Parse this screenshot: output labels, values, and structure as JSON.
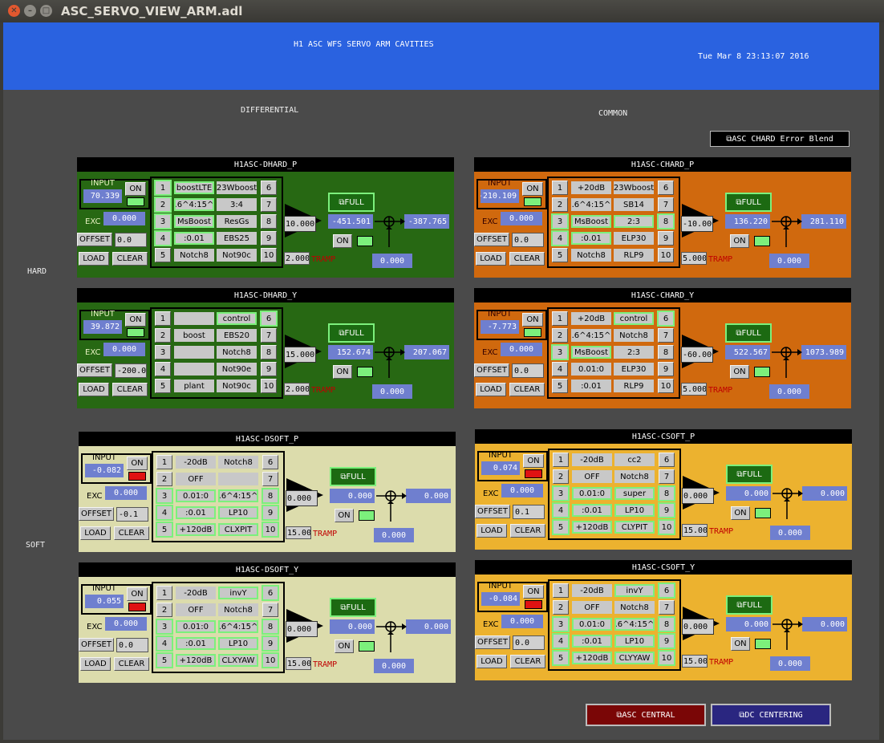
{
  "window": {
    "title": "ASC_SERVO_VIEW_ARM.adl"
  },
  "header": {
    "title": "H1 ASC WFS SERVO ARM CAVITIES",
    "datetime": "Tue Mar  8 23:13:07 2016"
  },
  "labels": {
    "differential": "DIFFERENTIAL",
    "common": "COMMON",
    "hard": "HARD",
    "soft": "SOFT"
  },
  "blend_button": "⧉ASC CHARD Error Blend",
  "common_labels": {
    "input": "INPUT",
    "exc": "EXC",
    "on": "ON",
    "offset": "OFFSET",
    "load": "LOAD",
    "clear": "CLEAR",
    "full": "⧉FULL",
    "tramp": "TRAMP"
  },
  "panels": [
    {
      "title": "H1ASC-DHARD_P",
      "input": "70.339",
      "exc": "0.000",
      "offset": "0.0",
      "gain": "10.000",
      "tramp": "2.000",
      "filters": [
        "boostLTE",
        ".6^4:15^",
        "MsBoost",
        ":0.01",
        "Notch8",
        "23Wboost",
        "3:4",
        "ResGs",
        "EBS25",
        "Not90c"
      ],
      "filter_on": [
        true,
        true,
        true,
        true,
        false,
        false,
        false,
        false,
        false,
        false
      ],
      "inmon": "-451.501",
      "out": "-387.765",
      "bottom": "0.000",
      "input_led": "on",
      "out_led": "on"
    },
    {
      "title": "H1ASC-DHARD_Y",
      "input": "39.872",
      "exc": "0.000",
      "offset": "-200.0",
      "gain": "15.000",
      "tramp": "2.000",
      "filters": [
        "",
        "boost",
        "",
        "",
        "plant",
        "control",
        "EBS20",
        "Notch8",
        "Not90e",
        "Not90c"
      ],
      "filter_on": [
        false,
        false,
        false,
        false,
        false,
        true,
        false,
        false,
        false,
        false
      ],
      "inmon": "152.674",
      "out": "207.067",
      "bottom": "0.000",
      "input_led": "on",
      "out_led": "on"
    },
    {
      "title": "H1ASC-DSOFT_P",
      "input": "-0.082",
      "exc": "0.000",
      "offset": "-0.1",
      "gain": "0.000",
      "tramp": "15.000",
      "filters": [
        "-20dB",
        "OFF",
        "0.01:0",
        ":0.01",
        "+120dB",
        "Notch8",
        "",
        ".6^4:15^",
        "LP10",
        "CLXPIT"
      ],
      "filter_on": [
        false,
        false,
        true,
        true,
        true,
        false,
        false,
        true,
        true,
        true
      ],
      "inmon": "0.000",
      "out": "0.000",
      "bottom": "0.000",
      "input_led": "off",
      "out_led": "on"
    },
    {
      "title": "H1ASC-DSOFT_Y",
      "input": "0.055",
      "exc": "0.000",
      "offset": "0.0",
      "gain": "0.000",
      "tramp": "15.000",
      "filters": [
        "-20dB",
        "OFF",
        "0.01:0",
        ":0.01",
        "+120dB",
        "invY",
        "Notch8",
        ".6^4:15^",
        "LP10",
        "CLXYAW"
      ],
      "filter_on": [
        false,
        false,
        true,
        true,
        true,
        true,
        false,
        true,
        true,
        true
      ],
      "inmon": "0.000",
      "out": "0.000",
      "bottom": "0.000",
      "input_led": "off",
      "out_led": "on"
    },
    {
      "title": "H1ASC-CHARD_P",
      "input": "-210.109",
      "exc": "0.000",
      "offset": "0.0",
      "gain": "-10.000",
      "tramp": "5.000",
      "filters": [
        "+20dB",
        ".6^4:15^",
        "MsBoost",
        ":0.01",
        "Notch8",
        "23Wboost",
        "SB14",
        "2:3",
        "ELP30",
        "RLP9"
      ],
      "filter_on": [
        false,
        false,
        true,
        true,
        false,
        false,
        false,
        true,
        false,
        false
      ],
      "inmon": "136.220",
      "out": "281.110",
      "bottom": "0.000",
      "input_led": "on",
      "out_led": "on"
    },
    {
      "title": "H1ASC-CHARD_Y",
      "input": "-7.773",
      "exc": "0.000",
      "offset": "0.0",
      "gain": "-60.000",
      "tramp": "5.000",
      "filters": [
        "+20dB",
        ".6^4:15^",
        "MsBoost",
        "0.01:0",
        ":0.01",
        "control",
        "Notch8",
        "2:3",
        "ELP30",
        "RLP9"
      ],
      "filter_on": [
        false,
        false,
        true,
        false,
        false,
        true,
        false,
        false,
        false,
        false
      ],
      "inmon": "522.567",
      "out": "1073.989",
      "bottom": "0.000",
      "input_led": "on",
      "out_led": "on"
    },
    {
      "title": "H1ASC-CSOFT_P",
      "input": "0.074",
      "exc": "0.000",
      "offset": "0.1",
      "gain": "0.000",
      "tramp": "15.000",
      "filters": [
        "-20dB",
        "OFF",
        "0.01:0",
        ":0.01",
        "+120dB",
        "cc2",
        "Notch8",
        "super",
        "LP10",
        "CLYPIT"
      ],
      "filter_on": [
        false,
        false,
        true,
        true,
        true,
        false,
        false,
        true,
        true,
        true
      ],
      "inmon": "0.000",
      "out": "0.000",
      "bottom": "0.000",
      "input_led": "off",
      "out_led": "on"
    },
    {
      "title": "H1ASC-CSOFT_Y",
      "input": "-0.084",
      "exc": "0.000",
      "offset": "0.0",
      "gain": "0.000",
      "tramp": "15.000",
      "filters": [
        "-20dB",
        "OFF",
        "0.01:0",
        ":0.01",
        "+120dB",
        "invY",
        "Notch8",
        ".6^4:15^",
        "LP10",
        "CLYYAW"
      ],
      "filter_on": [
        false,
        false,
        true,
        true,
        true,
        true,
        false,
        true,
        true,
        true
      ],
      "inmon": "0.000",
      "out": "0.000",
      "bottom": "0.000",
      "input_led": "off",
      "out_led": "on"
    }
  ],
  "bottom_buttons": {
    "asc_central": "⧉ASC CENTRAL",
    "dc_centering": "⧉DC CENTERING"
  },
  "colors": {
    "header_blue": "#2a62e0",
    "hard_diff": "#276813",
    "hard_common": "#d0690e",
    "soft_diff": "#dcdcac",
    "soft_common": "#ecb22f",
    "value_box": "#6f7fcf",
    "led_green": "#7cf07c",
    "led_red": "#e01212"
  }
}
